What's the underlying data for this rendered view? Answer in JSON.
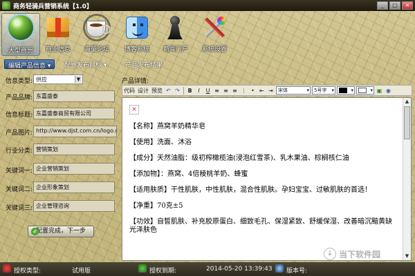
{
  "window": {
    "title": "商务轻骑兵营销系统【1.0】",
    "controls": [
      "_",
      "□",
      "×"
    ]
  },
  "toolbar": [
    {
      "label": "大型商贸",
      "icon": "globe-icon",
      "active": true
    },
    {
      "label": "商业信息",
      "icon": "package-icon",
      "active": false
    },
    {
      "label": "海量论坛",
      "icon": "coffee-cup-icon",
      "active": false
    },
    {
      "label": "博客系统",
      "icon": "finder-face-icon",
      "active": false
    },
    {
      "label": "新闻门户",
      "icon": "chess-pawn-icon",
      "active": false
    },
    {
      "label": "系统设置",
      "icon": "tools-icon",
      "active": false
    }
  ],
  "subtabs": [
    {
      "label": "编辑产品信息 ▾",
      "active": true
    },
    {
      "label": "配置发布目标 ▾",
      "active": false
    },
    {
      "label": "产品发布结果",
      "active": false
    }
  ],
  "form": {
    "info_type_label": "信息类型:",
    "info_type_value": "供应",
    "brand_label": "产品品牌:",
    "brand_value": "东嘉盛泰",
    "title_label": "信息标题:",
    "title_value": "东嘉盛泰商贸有限公司",
    "image_label": "产品图片:",
    "image_value": "http://www.djst.com.cn/logo.g",
    "category_label": "行业分类:",
    "category_value": "营销策划",
    "kw1_label": "关键词一:",
    "kw1_value": "企业营销策划",
    "kw2_label": "关键词二:",
    "kw2_value": "企业形象策划",
    "kw3_label": "关键词三:",
    "kw3_value": "企业管理咨询",
    "next_button": "配置完成，下一步"
  },
  "editor": {
    "label": "产品详情:",
    "toolbar": {
      "code": "代码",
      "design": "设计",
      "preview": "预览",
      "font": "宋体",
      "size": "5号字"
    },
    "paragraphs": [
      "【名称】燕窝羊奶精华皂",
      "【使用】洗面、沐浴",
      "【成分】天然油脂：级初榨橄榄油(浸泡红雪茶)、乳木果油、棕榈核仁油",
      "【添加物】：燕窝、4倍稜桃羊奶、蜂蜜",
      "【适用肤质】干性肌肤，中性肌肤，混合性肌肤。孕妇宝宝、过敏肌肤的首选！",
      "【净重】70克±5",
      "【功效】自皙肌肤、补充胶原蛋白、细致毛孔、保湿紧致、舒缓保湿、改善暗沉黯黄缺光泽肤色"
    ]
  },
  "watermark": "当下软件园",
  "status": {
    "auth_type_label": "授权类型:",
    "auth_type_value": "试用版",
    "expire_label": "授权到期:",
    "datetime": "2014-05-20 13:39:43",
    "version_label": "版本号:"
  },
  "colors": {
    "background": "#cbbf8a",
    "titlebar": "#2a2416",
    "active_tab": "#2c4f84",
    "status_bar": "#2e2b1e"
  }
}
